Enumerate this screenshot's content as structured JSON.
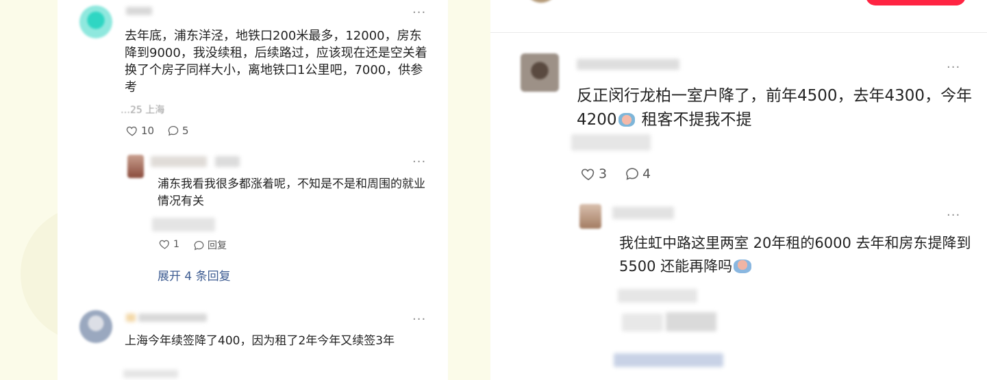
{
  "left": {
    "comment1": {
      "text": "去年底，浦东洋泾，地铁口200米最多，12000，房东降到9000，我没续租，后续路过，应该现在还是空关着 换了个房子同样大小，离地铁口1公里吧，7000，供参考",
      "meta": "…25 上海",
      "likes": "10",
      "replies": "5"
    },
    "reply1": {
      "text": "浦东我看我很多都涨着呢，不知是不是和周围的就业情况有关",
      "likes": "1",
      "reply_label": "回复"
    },
    "expand_label": "展开 4 条回复",
    "comment2": {
      "text": "上海今年续签降了400，因为租了2年今年又续签3年"
    }
  },
  "right": {
    "comment1": {
      "text": "反正闵行龙柏一室户降了，前年4500，去年4300，今年4200",
      "text_tail": "租客不提我不提",
      "likes": "3",
      "replies": "4"
    },
    "reply1": {
      "text": "我住虹中路这里两室 20年租的6000 去年和房东提降到5500 还能再降吗"
    }
  },
  "more_glyph": "···",
  "colors": {
    "link": "#3c5b91",
    "brand": "#ff2442",
    "background": "#fbfbe9"
  }
}
